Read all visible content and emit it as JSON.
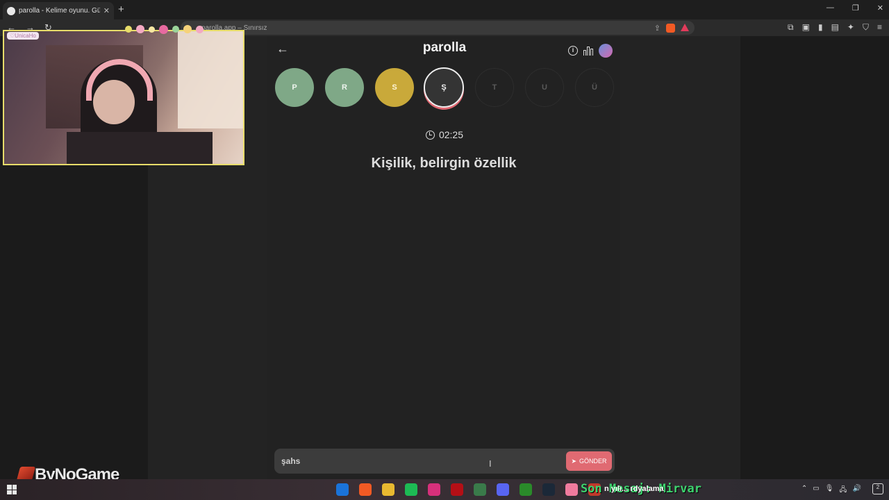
{
  "browser": {
    "tab_title": "parolla - Kelime oyunu. Günlük",
    "tab_close": "✕",
    "new_tab": "+",
    "window_controls": [
      "—",
      "❐",
      "✕"
    ],
    "nav": [
      "←",
      "→",
      "↻"
    ],
    "url_text": "parolla.app – Sınırsız",
    "toolbar_icons": [
      "puzzle-icon",
      "screenshot-icon",
      "sidebar-icon",
      "wallet-icon",
      "leo-icon",
      "vpn-icon",
      "menu-icon"
    ]
  },
  "header": {
    "back": "←",
    "title": "parolla",
    "info": "i"
  },
  "letters": [
    {
      "char": "P",
      "state": "correct"
    },
    {
      "char": "R",
      "state": "correct"
    },
    {
      "char": "S",
      "state": "passed"
    },
    {
      "char": "Ş",
      "state": "current"
    },
    {
      "char": "T",
      "state": "pending"
    },
    {
      "char": "U",
      "state": "pending"
    },
    {
      "char": "Ü",
      "state": "pending"
    }
  ],
  "timer": "02:25",
  "clue": "Kişilik, belirgin özellik",
  "answer": {
    "value": "şahs",
    "send_label": "GÖNDER",
    "send_icon": "➤"
  },
  "webcam": {
    "tag": "♡UnicaHo"
  },
  "watermark": "ByNoGame",
  "taskbar": {
    "ticker": "Son Mesaj: Mirvar",
    "ticker_sub": "n yılı... rdyalama",
    "apps": [
      {
        "name": "outlook-icon",
        "color": "#1a73d9"
      },
      {
        "name": "brave-icon",
        "color": "#f25a24"
      },
      {
        "name": "chrome-icon",
        "color": "#e9b930"
      },
      {
        "name": "spotify-icon",
        "color": "#1db954"
      },
      {
        "name": "instagram-icon",
        "color": "#d6307b"
      },
      {
        "name": "netflix-icon",
        "color": "#b50f16"
      },
      {
        "name": "app-icon",
        "color": "#3a7a4a"
      },
      {
        "name": "discord-icon",
        "color": "#5865f2"
      },
      {
        "name": "xbox-icon",
        "color": "#2a8a2a"
      },
      {
        "name": "steam-icon",
        "color": "#1b2838"
      },
      {
        "name": "obs-icon",
        "color": "#f07b9e"
      },
      {
        "name": "media-icon",
        "color": "#c0392b"
      }
    ],
    "tray": [
      "⌃",
      "▭",
      "🎙",
      "🖧",
      "🔊"
    ],
    "notifications": "2"
  }
}
